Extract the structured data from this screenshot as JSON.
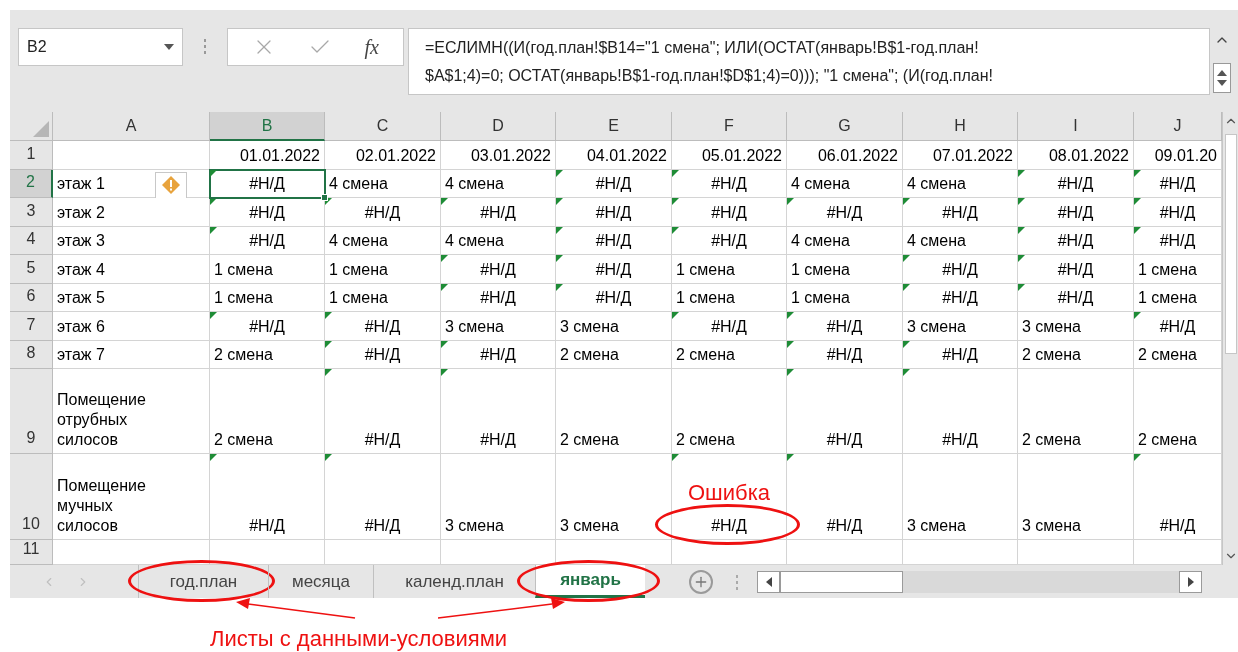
{
  "formula_bar": {
    "name_box": "B2",
    "function_label": "fx",
    "lines": [
      "=ЕСЛИМН((И(год.план!$B14=\"1 смена\"; ИЛИ(ОСТАТ(январь!B$1-год.план!",
      "$A$1;4)=0; ОСТАТ(январь!B$1-год.план!$D$1;4)=0))); \"1 смена\"; (И(год.план!"
    ]
  },
  "columns": [
    {
      "label": "A",
      "selected": false
    },
    {
      "label": "B",
      "selected": true
    },
    {
      "label": "C",
      "selected": false
    },
    {
      "label": "D",
      "selected": false
    },
    {
      "label": "E",
      "selected": false
    },
    {
      "label": "F",
      "selected": false
    },
    {
      "label": "G",
      "selected": false
    },
    {
      "label": "H",
      "selected": false
    },
    {
      "label": "I",
      "selected": false
    },
    {
      "label": "J",
      "selected": false
    }
  ],
  "rows": [
    {
      "label": "1",
      "selected": false,
      "cells": [
        {
          "kind": "blank",
          "selected": false
        },
        {
          "value": "01.01.2022",
          "kind": "date",
          "selected": false
        },
        {
          "value": "02.01.2022",
          "kind": "date",
          "selected": false
        },
        {
          "value": "03.01.2022",
          "kind": "date",
          "selected": false
        },
        {
          "value": "04.01.2022",
          "kind": "date",
          "selected": false
        },
        {
          "value": "05.01.2022",
          "kind": "date",
          "selected": false
        },
        {
          "value": "06.01.2022",
          "kind": "date",
          "selected": false
        },
        {
          "value": "07.01.2022",
          "kind": "date",
          "selected": false
        },
        {
          "value": "08.01.2022",
          "kind": "date",
          "selected": false
        },
        {
          "value": "09.01.20",
          "kind": "date",
          "selected": false
        }
      ]
    },
    {
      "label": "2",
      "selected": true,
      "cells": [
        {
          "value": "этаж 1",
          "kind": "text",
          "selected": false,
          "smart_tag": true
        },
        {
          "value": "#Н/Д",
          "kind": "error",
          "selected": true
        },
        {
          "value": "4 смена",
          "kind": "text",
          "selected": false
        },
        {
          "value": "4 смена",
          "kind": "text",
          "selected": false
        },
        {
          "value": "#Н/Д",
          "kind": "error",
          "selected": false
        },
        {
          "value": "#Н/Д",
          "kind": "error",
          "selected": false
        },
        {
          "value": "4 смена",
          "kind": "text",
          "selected": false
        },
        {
          "value": "4 смена",
          "kind": "text",
          "selected": false
        },
        {
          "value": "#Н/Д",
          "kind": "error",
          "selected": false
        },
        {
          "value": "#Н/Д",
          "kind": "error",
          "selected": false
        }
      ]
    },
    {
      "label": "3",
      "selected": false,
      "cells": [
        {
          "value": "этаж 2",
          "kind": "text",
          "selected": false
        },
        {
          "value": "#Н/Д",
          "kind": "error",
          "selected": false
        },
        {
          "value": "#Н/Д",
          "kind": "error",
          "selected": false
        },
        {
          "value": "#Н/Д",
          "kind": "error",
          "selected": false
        },
        {
          "value": "#Н/Д",
          "kind": "error",
          "selected": false
        },
        {
          "value": "#Н/Д",
          "kind": "error",
          "selected": false
        },
        {
          "value": "#Н/Д",
          "kind": "error",
          "selected": false
        },
        {
          "value": "#Н/Д",
          "kind": "error",
          "selected": false
        },
        {
          "value": "#Н/Д",
          "kind": "error",
          "selected": false
        },
        {
          "value": "#Н/Д",
          "kind": "error",
          "selected": false
        }
      ]
    },
    {
      "label": "4",
      "selected": false,
      "cells": [
        {
          "value": "этаж 3",
          "kind": "text",
          "selected": false
        },
        {
          "value": "#Н/Д",
          "kind": "error",
          "selected": false
        },
        {
          "value": "4 смена",
          "kind": "text",
          "selected": false
        },
        {
          "value": "4 смена",
          "kind": "text",
          "selected": false
        },
        {
          "value": "#Н/Д",
          "kind": "error",
          "selected": false
        },
        {
          "value": "#Н/Д",
          "kind": "error",
          "selected": false
        },
        {
          "value": "4 смена",
          "kind": "text",
          "selected": false
        },
        {
          "value": "4 смена",
          "kind": "text",
          "selected": false
        },
        {
          "value": "#Н/Д",
          "kind": "error",
          "selected": false
        },
        {
          "value": "#Н/Д",
          "kind": "error",
          "selected": false
        }
      ]
    },
    {
      "label": "5",
      "selected": false,
      "cells": [
        {
          "value": "этаж 4",
          "kind": "text",
          "selected": false
        },
        {
          "value": "1 смена",
          "kind": "text",
          "selected": false
        },
        {
          "value": "1 смена",
          "kind": "text",
          "selected": false
        },
        {
          "value": "#Н/Д",
          "kind": "error",
          "selected": false
        },
        {
          "value": "#Н/Д",
          "kind": "error",
          "selected": false
        },
        {
          "value": "1 смена",
          "kind": "text",
          "selected": false
        },
        {
          "value": "1 смена",
          "kind": "text",
          "selected": false
        },
        {
          "value": "#Н/Д",
          "kind": "error",
          "selected": false
        },
        {
          "value": "#Н/Д",
          "kind": "error",
          "selected": false
        },
        {
          "value": "1 смена",
          "kind": "text",
          "selected": false
        }
      ]
    },
    {
      "label": "6",
      "selected": false,
      "cells": [
        {
          "value": "этаж 5",
          "kind": "text",
          "selected": false
        },
        {
          "value": "1 смена",
          "kind": "text",
          "selected": false
        },
        {
          "value": "1 смена",
          "kind": "text",
          "selected": false
        },
        {
          "value": "#Н/Д",
          "kind": "error",
          "selected": false
        },
        {
          "value": "#Н/Д",
          "kind": "error",
          "selected": false
        },
        {
          "value": "1 смена",
          "kind": "text",
          "selected": false
        },
        {
          "value": "1 смена",
          "kind": "text",
          "selected": false
        },
        {
          "value": "#Н/Д",
          "kind": "error",
          "selected": false
        },
        {
          "value": "#Н/Д",
          "kind": "error",
          "selected": false
        },
        {
          "value": "1 смена",
          "kind": "text",
          "selected": false
        }
      ]
    },
    {
      "label": "7",
      "selected": false,
      "cells": [
        {
          "value": "этаж 6",
          "kind": "text",
          "selected": false
        },
        {
          "value": "#Н/Д",
          "kind": "error",
          "selected": false
        },
        {
          "value": "#Н/Д",
          "kind": "error",
          "selected": false
        },
        {
          "value": "3 смена",
          "kind": "text",
          "selected": false
        },
        {
          "value": "3 смена",
          "kind": "text",
          "selected": false
        },
        {
          "value": "#Н/Д",
          "kind": "error",
          "selected": false
        },
        {
          "value": "#Н/Д",
          "kind": "error",
          "selected": false
        },
        {
          "value": "3 смена",
          "kind": "text",
          "selected": false
        },
        {
          "value": "3 смена",
          "kind": "text",
          "selected": false
        },
        {
          "value": "#Н/Д",
          "kind": "error",
          "selected": false
        }
      ]
    },
    {
      "label": "8",
      "selected": false,
      "cells": [
        {
          "value": "этаж 7",
          "kind": "text",
          "selected": false
        },
        {
          "value": "2 смена",
          "kind": "text",
          "selected": false
        },
        {
          "value": "#Н/Д",
          "kind": "error",
          "selected": false
        },
        {
          "value": "#Н/Д",
          "kind": "error",
          "selected": false
        },
        {
          "value": "2 смена",
          "kind": "text",
          "selected": false
        },
        {
          "value": "2 смена",
          "kind": "text",
          "selected": false
        },
        {
          "value": "#Н/Д",
          "kind": "error",
          "selected": false
        },
        {
          "value": "#Н/Д",
          "kind": "error",
          "selected": false
        },
        {
          "value": "2 смена",
          "kind": "text",
          "selected": false
        },
        {
          "value": "2 смена",
          "kind": "text",
          "selected": false
        }
      ]
    },
    {
      "label": "9",
      "selected": false,
      "cells": [
        {
          "value": "Помещение отрубных силосов",
          "kind": "text",
          "selected": false
        },
        {
          "value": "2 смена",
          "kind": "text",
          "selected": false
        },
        {
          "value": "#Н/Д",
          "kind": "error",
          "selected": false
        },
        {
          "value": "#Н/Д",
          "kind": "error",
          "selected": false
        },
        {
          "value": "2 смена",
          "kind": "text",
          "selected": false
        },
        {
          "value": "2 смена",
          "kind": "text",
          "selected": false
        },
        {
          "value": "#Н/Д",
          "kind": "error",
          "selected": false
        },
        {
          "value": "#Н/Д",
          "kind": "error",
          "selected": false
        },
        {
          "value": "2 смена",
          "kind": "text",
          "selected": false
        },
        {
          "value": "2 смена",
          "kind": "text",
          "selected": false
        }
      ]
    },
    {
      "label": "10",
      "selected": false,
      "cells": [
        {
          "value": "Помещение мучных силосов",
          "kind": "text",
          "selected": false
        },
        {
          "value": "#Н/Д",
          "kind": "error",
          "selected": false
        },
        {
          "value": "#Н/Д",
          "kind": "error",
          "selected": false
        },
        {
          "value": "3 смена",
          "kind": "text",
          "selected": false
        },
        {
          "value": "3 смена",
          "kind": "text",
          "selected": false
        },
        {
          "value": "#Н/Д",
          "kind": "error",
          "selected": false,
          "circled": true,
          "note": "Ошибка"
        },
        {
          "value": "#Н/Д",
          "kind": "error",
          "selected": false
        },
        {
          "value": "3 смена",
          "kind": "text",
          "selected": false
        },
        {
          "value": "3 смена",
          "kind": "text",
          "selected": false
        },
        {
          "value": "#Н/Д",
          "kind": "error",
          "selected": false
        }
      ]
    },
    {
      "label": "11",
      "selected": false
    }
  ],
  "sheet_tabs": [
    {
      "label": "год.план",
      "selected": false,
      "circled": true
    },
    {
      "label": "месяца",
      "selected": false,
      "circled": false
    },
    {
      "label": "календ.план",
      "selected": false,
      "circled": false
    },
    {
      "label": "январь",
      "selected": true,
      "circled": true
    }
  ],
  "caption": "Листы с данными-условиями"
}
